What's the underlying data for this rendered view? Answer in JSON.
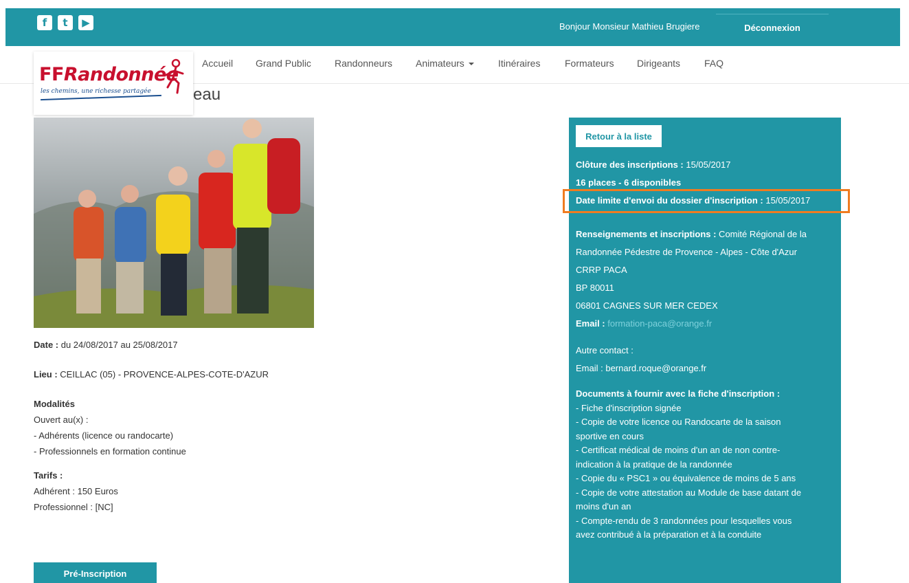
{
  "colors": {
    "primary": "#2196a5",
    "highlight": "#f07c20",
    "logo_red": "#c8102e",
    "logo_blue": "#1b4f8f"
  },
  "topbar": {
    "social_icons": [
      {
        "name": "facebook-icon",
        "glyph": "f"
      },
      {
        "name": "twitter-icon",
        "glyph": "t"
      },
      {
        "name": "youtube-icon",
        "glyph": "▶"
      }
    ],
    "greeting": "Bonjour Monsieur Mathieu Brugiere",
    "logout": "Déconnexion"
  },
  "logo": {
    "brand_ff": "FF",
    "brand_rando": "Randonnée",
    "tagline": "les chemins, une richesse partagée"
  },
  "nav": {
    "items": [
      "Accueil",
      "Grand Public",
      "Randonneurs",
      "Animateurs",
      "Itinéraires",
      "Formateurs",
      "Dirigeants",
      "FAQ"
    ]
  },
  "page": {
    "title_fragment": "eau"
  },
  "details": {
    "date_label": "Date :",
    "date_value": " du 24/08/2017 au 25/08/2017",
    "lieu_label": "Lieu :",
    "lieu_value": " CEILLAC (05) - PROVENCE-ALPES-COTE-D'AZUR",
    "modalites_title": "Modalités",
    "modalites_lines": [
      "Ouvert au(x) :",
      "- Adhérents (licence ou randocarte)",
      "- Professionnels en formation continue"
    ],
    "tarifs_title": "Tarifs :",
    "tarifs_lines": [
      "Adhérent : 150 Euros",
      "Professionnel : [NC]"
    ]
  },
  "buttons": {
    "preinscription": "Pré-Inscription",
    "back_to_list": "Retour à la liste"
  },
  "sidebar": {
    "cloture_label": "Clôture des inscriptions :",
    "cloture_value": " 15/05/2017",
    "places": "16 places - 6 disponibles",
    "date_limite_label": "Date limite d'envoi du dossier d'inscription :",
    "date_limite_value": " 15/05/2017",
    "renseignements_label": "Renseignements et inscriptions :",
    "renseignements_value": " Comité Régional de la",
    "address_lines": [
      "Randonnée Pédestre de Provence - Alpes - Côte d'Azur",
      "CRRP PACA",
      "BP 80011",
      "06801 CAGNES SUR MER CEDEX"
    ],
    "email_label": "Email :",
    "email_value": " formation-paca@orange.fr",
    "autre_contact": "Autre contact :",
    "email2": "Email : bernard.roque@orange.fr",
    "documents_title": "Documents à fournir avec la fiche d'inscription :",
    "documents_lines": [
      "- Fiche d'inscription signée",
      "- Copie de votre licence ou Randocarte de la saison",
      "sportive en cours",
      "- Certificat médical de moins d'un an de non contre-",
      "indication à la pratique de la randonnée",
      "- Copie du « PSC1 » ou équivalence de moins de 5 ans",
      "- Copie de votre attestation au Module de base datant de",
      "moins d'un an",
      "- Compte-rendu de 3 randonnées pour lesquelles vous",
      "avez contribué à la préparation et à la conduite"
    ]
  }
}
